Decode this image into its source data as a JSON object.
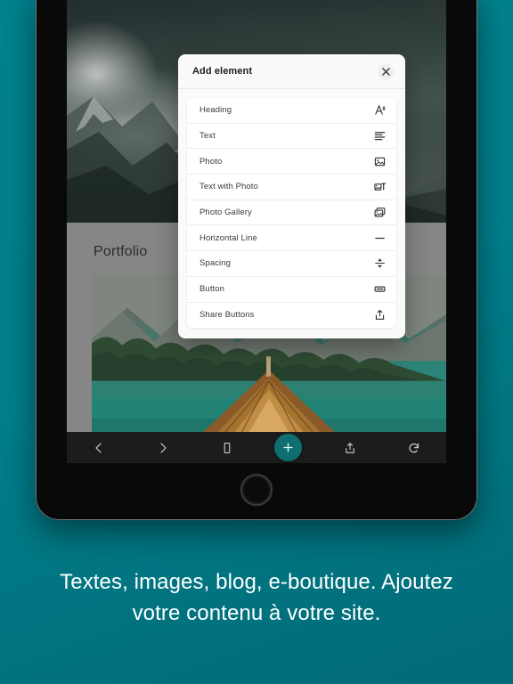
{
  "theme": {
    "background_teal": "#00818d",
    "accent_teal": "#0f6e6e",
    "toolbar_bg": "#1c1c1c",
    "dialog_bg": "#fafafa",
    "page_overlay_gray": "#868686"
  },
  "dialog": {
    "title": "Add element",
    "close_label": "×",
    "items": [
      {
        "label": "Heading",
        "icon": "heading-icon"
      },
      {
        "label": "Text",
        "icon": "text-lines-icon"
      },
      {
        "label": "Photo",
        "icon": "photo-icon"
      },
      {
        "label": "Text with Photo",
        "icon": "text-with-photo-icon"
      },
      {
        "label": "Photo Gallery",
        "icon": "photo-gallery-icon"
      },
      {
        "label": "Horizontal Line",
        "icon": "horizontal-line-icon"
      },
      {
        "label": "Spacing",
        "icon": "spacing-arrows-icon"
      },
      {
        "label": "Button",
        "icon": "button-icon"
      },
      {
        "label": "Share Buttons",
        "icon": "share-icon"
      }
    ]
  },
  "page": {
    "portfolio_heading": "Portfolio"
  },
  "toolbar": {
    "buttons": [
      {
        "name": "back-button",
        "icon": "chevron-left-icon"
      },
      {
        "name": "forward-button",
        "icon": "chevron-right-icon"
      },
      {
        "name": "device-preview-button",
        "icon": "phone-icon"
      },
      {
        "name": "add-button",
        "icon": "plus-icon"
      },
      {
        "name": "share-button",
        "icon": "share-icon"
      },
      {
        "name": "refresh-button",
        "icon": "refresh-icon"
      }
    ]
  },
  "caption": {
    "line1": "Textes, images, blog, e-boutique. Ajoutez",
    "line2": "votre contenu à votre site."
  }
}
